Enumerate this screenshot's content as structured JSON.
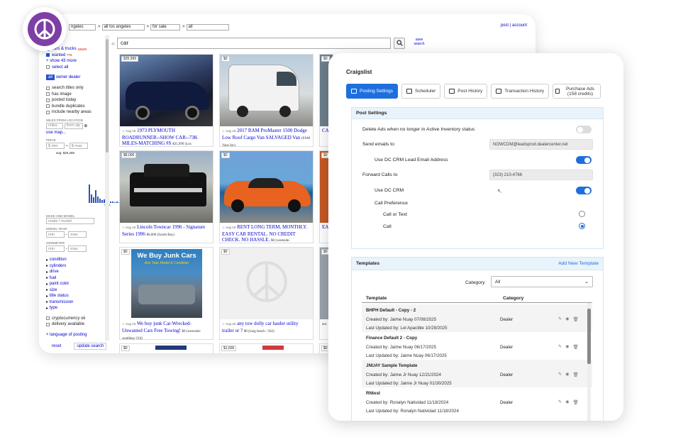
{
  "craigslist": {
    "topbar": {
      "loc1": "ngeles",
      "loc2": "all los angeles",
      "sec1": "for sale",
      "sec2": "all",
      "post": "post",
      "account": "account"
    },
    "sidebar": {
      "cars_label": "cars & trucks",
      "cars_count": "22629",
      "wanted_label": "wanted",
      "wanted_count": "776",
      "show_more": "+ show 43 more",
      "select_all": "select all",
      "all_btn": "all",
      "owner": "owner",
      "dealer": "dealer",
      "filters": [
        "search titles only",
        "has image",
        "posted today",
        "bundle duplicates",
        "include nearby areas"
      ],
      "miles_label": "MILES FROM LOCATION",
      "miles_ph": "miles",
      "zip_ph": "from zip",
      "use_map": "use map...",
      "price_label": "PRICE",
      "min_ph": "$ min",
      "max_ph": "$ max",
      "avg": "avg: $29,285",
      "hist_labels": [
        "$60k",
        "$100k+",
        "$1.3M"
      ],
      "make_label": "MAKE AND MODEL",
      "make_ph": "make / model",
      "year_label": "MODEL YEAR",
      "odo_label": "ODOMETER",
      "min": "min",
      "max": "max",
      "links": [
        "condition",
        "cylinders",
        "drive",
        "fuel",
        "paint color",
        "size",
        "title status",
        "transmission",
        "type"
      ],
      "crypto": "cryptocurrency ok",
      "delivery": "delivery available",
      "language": "+ language of posting",
      "reset": "reset",
      "update": "update search"
    },
    "search_value": "car",
    "save_search": "save search",
    "listings": [
      {
        "price": "$35,999",
        "date": "Aug 19",
        "title": "1973 PLYMOUTH ROADRUNNER--SHOW CAR--73K MILES-MATCHING #S",
        "meta": "$35,999 (Los"
      },
      {
        "price": "$0",
        "date": "Aug 19",
        "title": "2017 RAM ProMaster 1500 Dodge Low Roof Cargo Van SALVAGED Van",
        "meta": "(FAM Vans Inc)"
      },
      {
        "price": "$0",
        "date": "",
        "title": "CA",
        "meta": ""
      },
      {
        "price": "$8,000",
        "date": "Aug 19",
        "title": "Lincoln Towncar 1996 - Signature Series 1996",
        "meta": "$8,000 (South Bay)"
      },
      {
        "price": "$0",
        "date": "Aug 19",
        "title": "RENT LONG TERM, MONTHLY. EASY CAR RENTAL. NO CREDIT CHECK. NO HASSLE.",
        "meta": "$0 (westside-"
      },
      {
        "price": "$0",
        "date": "",
        "title": "EA",
        "meta": ""
      },
      {
        "price": "$0",
        "date": "Aug 19",
        "title": "We buy junk Car-Wrecked-Unwanted Cars Free Towing!",
        "meta": "$0 (westside-southbay-310)",
        "ad1": "We Buy Junk Cars",
        "ad2": "Any Year Model & Condition"
      },
      {
        "price": "$0",
        "date": "Aug 19",
        "title": "any tow dolly car hauler utility trailer or ?",
        "meta": "$0 (long beach / 562)"
      },
      {
        "price": "$0",
        "date": "",
        "title": "",
        "meta": "anc"
      },
      {
        "price": "$0",
        "date": "",
        "title": "",
        "meta": ""
      },
      {
        "price": "$1,500",
        "date": "",
        "title": "",
        "meta": ""
      },
      {
        "price": "$0",
        "date": "",
        "title": "",
        "meta": ""
      }
    ]
  },
  "dc": {
    "title": "Craigslist",
    "tabs": [
      "Posting Settings",
      "Scheduler",
      "Post History",
      "Transaction History",
      "Purchase Ads (158 credits)"
    ],
    "posting": {
      "header": "Post Settings",
      "delete_label": "Delete Ads when no longer in Active Inventory status",
      "send_label": "Send emails to",
      "send_value": "NOWCDM@leadsprod.dealercenter.net",
      "use_email": "Use DC CRM Lead Email Address",
      "forward_label": "Forward Calls to",
      "forward_value": "(323) 210-4766",
      "use_crm": "Use DC CRM",
      "call_pref": "Call Preference",
      "call_text": "Call or Text",
      "call": "Call",
      "toggles": {
        "delete": false,
        "use_email": true,
        "use_crm": true
      },
      "selected_pref": "Call"
    },
    "templates": {
      "header": "Templates",
      "add": "Add New Template",
      "category_label": "Category",
      "category_value": "All",
      "col_template": "Template",
      "col_category": "Category",
      "rows": [
        {
          "name": "BHPH Default - Copy - 2",
          "created": "Created by: Jaime Nuay 07/08/2025",
          "updated": "Last Updated by: Lel Apacible 10/29/2025",
          "category": "Dealer"
        },
        {
          "name": "Finance Default 2 - Copy",
          "created": "Created by: Jaime Nuay 06/17/2025",
          "updated": "Last Updated by: Jaime Nuay 06/17/2025",
          "category": "Dealer"
        },
        {
          "name": "JNUAY Sample Template",
          "created": "Created by: Jaime Jr Nuay 12/21/2024",
          "updated": "Last Updated by: Jaime Jr Nuay 01/30/2025",
          "category": "Dealer"
        },
        {
          "name": "RNtest",
          "created": "Created by: Ronalyn Natividad 11/18/2024",
          "updated": "Last Updated by: Ronalyn Natividad 11/18/2024",
          "category": "Dealer"
        }
      ]
    }
  },
  "colors": {
    "accent": "#1e6fde",
    "brand": "#7d3fa6",
    "link": "#0000cc",
    "panel_header": "#e8f3fb"
  }
}
